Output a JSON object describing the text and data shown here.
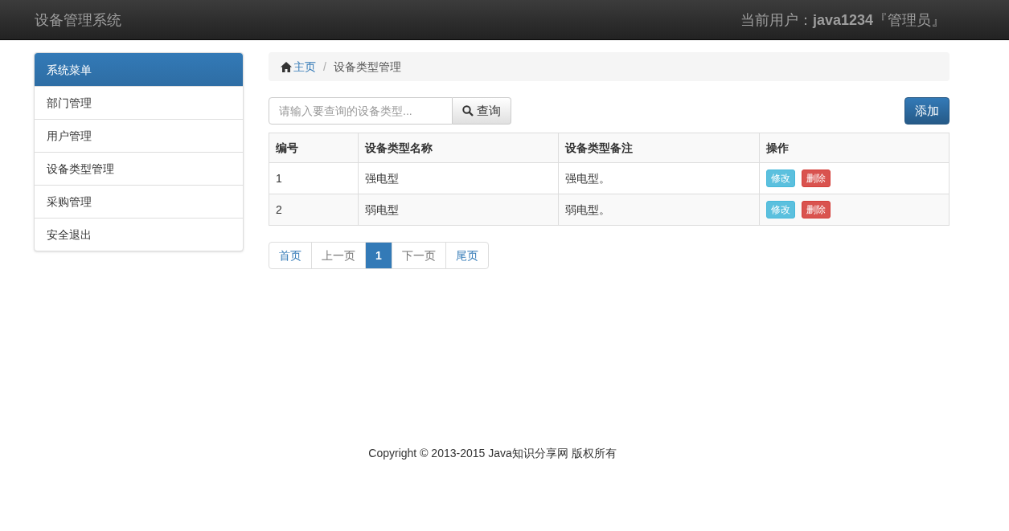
{
  "navbar": {
    "brand": "设备管理系统",
    "user_label": "当前用户：",
    "user_name": "java1234",
    "user_role": "『管理员』"
  },
  "sidebar": {
    "heading": "系统菜单",
    "items": [
      {
        "label": "部门管理"
      },
      {
        "label": "用户管理"
      },
      {
        "label": "设备类型管理"
      },
      {
        "label": "采购管理"
      },
      {
        "label": "安全退出"
      }
    ]
  },
  "breadcrumb": [
    {
      "label": "主页",
      "kind": "home"
    },
    {
      "label": "/",
      "kind": "separator"
    },
    {
      "label": "设备类型管理",
      "kind": "current"
    }
  ],
  "search": {
    "placeholder": "请输入要查询的设备类型...",
    "button": "查询"
  },
  "add_button": "添加",
  "table": {
    "columns": [
      "编号",
      "设备类型名称",
      "设备类型备注",
      "操作"
    ],
    "rows": [
      {
        "cells": [
          "1",
          "强电型",
          "强电型。"
        ],
        "actions": [
          "修改",
          "删除"
        ]
      },
      {
        "cells": [
          "2",
          "弱电型",
          "弱电型。"
        ],
        "actions": [
          "修改",
          "删除"
        ]
      }
    ]
  },
  "pagination": [
    {
      "label": "首页",
      "selected": false,
      "disabled": false
    },
    {
      "label": "上一页",
      "selected": false,
      "disabled": true
    },
    {
      "label": "1",
      "selected": true,
      "disabled": false
    },
    {
      "label": "下一页",
      "selected": false,
      "disabled": true
    },
    {
      "label": "尾页",
      "selected": false,
      "disabled": false
    }
  ],
  "footer": "Copyright © 2013-2015 Java知识分享网 版权所有"
}
